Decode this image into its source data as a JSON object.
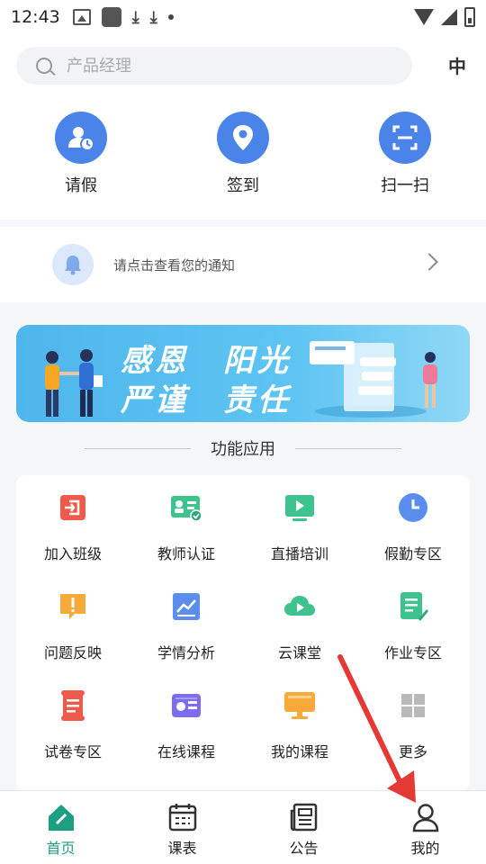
{
  "status_bar": {
    "time": "12:43"
  },
  "search": {
    "placeholder": "产品经理",
    "lang_label": "中"
  },
  "quick_actions": [
    {
      "label": "请假",
      "icon": "user-clock-icon"
    },
    {
      "label": "签到",
      "icon": "location-pin-icon"
    },
    {
      "label": "扫一扫",
      "icon": "scan-icon"
    }
  ],
  "notice": {
    "text": "请点击查看您的通知"
  },
  "banner": {
    "line1": "感恩　阳光",
    "line2": "严谨　责任"
  },
  "section": {
    "title": "功能应用"
  },
  "functions": [
    {
      "label": "加入班级",
      "icon": "join-class-icon",
      "color": "#f05a4a"
    },
    {
      "label": "教师认证",
      "icon": "teacher-id-icon",
      "color": "#3ec38f"
    },
    {
      "label": "直播培训",
      "icon": "live-play-icon",
      "color": "#3ec38f"
    },
    {
      "label": "假勤专区",
      "icon": "clock-icon",
      "color": "#5b8def"
    },
    {
      "label": "问题反映",
      "icon": "warning-icon",
      "color": "#f7a93a"
    },
    {
      "label": "学情分析",
      "icon": "analysis-chart-icon",
      "color": "#5b8def"
    },
    {
      "label": "云课堂",
      "icon": "cloud-play-icon",
      "color": "#3ec38f"
    },
    {
      "label": "作业专区",
      "icon": "homework-icon",
      "color": "#3ec38f"
    },
    {
      "label": "试卷专区",
      "icon": "exam-paper-icon",
      "color": "#f05a4a"
    },
    {
      "label": "在线课程",
      "icon": "online-course-icon",
      "color": "#7b6cf0"
    },
    {
      "label": "我的课程",
      "icon": "my-course-icon",
      "color": "#f7a93a"
    },
    {
      "label": "更多",
      "icon": "more-grid-icon",
      "color": "#b9b9b9"
    }
  ],
  "tabs": [
    {
      "label": "首页",
      "icon": "home-icon",
      "active": true
    },
    {
      "label": "课表",
      "icon": "calendar-icon",
      "active": false
    },
    {
      "label": "公告",
      "icon": "newspaper-icon",
      "active": false
    },
    {
      "label": "我的",
      "icon": "person-icon",
      "active": false
    }
  ],
  "colors": {
    "accent_green": "#1e9e83",
    "primary_blue": "#4b84e8",
    "annotation_red": "#e53935"
  }
}
